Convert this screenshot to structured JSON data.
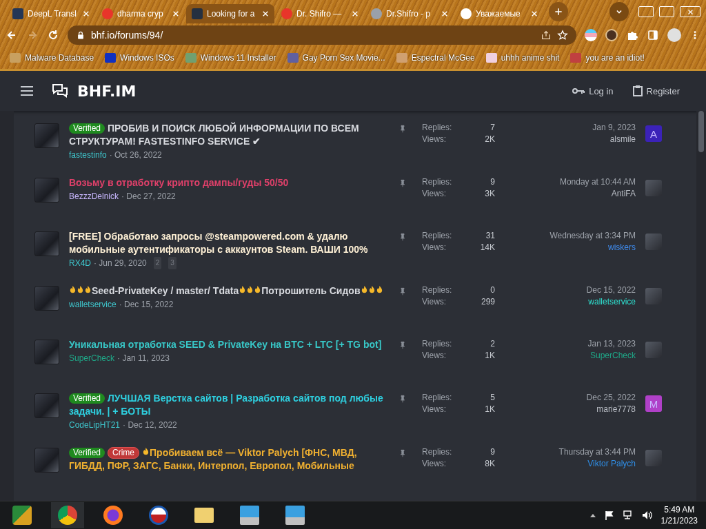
{
  "browser": {
    "tabs": [
      {
        "title": "DeepL Transl",
        "selected": false
      },
      {
        "title": "dharma cryp",
        "selected": false
      },
      {
        "title": "Looking for a",
        "selected": true
      },
      {
        "title": "Dr. Shifro —",
        "selected": false
      },
      {
        "title": "Dr.Shifro - p",
        "selected": false
      },
      {
        "title": "Уважаемые",
        "selected": false
      }
    ],
    "url": "bhf.io/forums/94/",
    "bookmarks": [
      "Malware Database",
      "Windows ISOs",
      "Windows 11 Installer",
      "Gay Porn Sex Movie...",
      "Espectral McGee",
      "uhhh anime shit",
      "you are an idiot!"
    ]
  },
  "site": {
    "logo": "BHF.IM",
    "login": "Log in",
    "register": "Register"
  },
  "threads": [
    {
      "avatar": {
        "kind": "image"
      },
      "prefixes": [
        {
          "kind": "verified",
          "label": "Verified"
        }
      ],
      "title": [
        {
          "kind": "text",
          "text": "ПРОБИВ И ПОИСК ЛЮБОЙ ИНФОРМАЦИИ ПО ВСЕМ СТРУКТУРАМ! FASTESTINFO SERVICE ✔"
        }
      ],
      "color": "#d8dadf",
      "author": {
        "name": "fastestinfo",
        "color": "#3fc9d0"
      },
      "date": "· Oct 26, 2022",
      "replies_label": "Replies:",
      "replies": "7",
      "views_label": "Views:",
      "views": "2K",
      "last_date": "Jan 9, 2023",
      "last_poster": {
        "name": "alsmile",
        "color": "#b8bcc4"
      },
      "last_avatar": {
        "kind": "letter",
        "letter": "A",
        "color": "#3b22b8"
      }
    },
    {
      "avatar": {
        "kind": "image"
      },
      "title": [
        {
          "kind": "text",
          "text": "Возьму в отработку крипто дампы/гуды 50/50"
        }
      ],
      "color": "#e0406a",
      "author": {
        "name": "BezzzDelnick",
        "color": "#c9b8ff"
      },
      "date": "· Dec 27, 2022",
      "replies_label": "Replies:",
      "replies": "9",
      "views_label": "Views:",
      "views": "3K",
      "last_date": "Monday at 10:44 AM",
      "last_poster": {
        "name": "AntiFA",
        "color": "#b8bcc4"
      },
      "last_avatar": {
        "kind": "image"
      }
    },
    {
      "avatar": {
        "kind": "image"
      },
      "title": [
        {
          "kind": "text",
          "text": "[FREE] Обработаю запросы @steampowered.com & удалю мобильные аутентификаторы с аккаунтов Steam. ВАШИ 100%"
        }
      ],
      "color": "#fff1d6",
      "author": {
        "name": "RX4D",
        "color": "#3fc9d0"
      },
      "date": "· Jun 29, 2020",
      "pages": [
        "2",
        "3"
      ],
      "replies_label": "Replies:",
      "replies": "31",
      "views_label": "Views:",
      "views": "14K",
      "last_date": "Wednesday at 3:34 PM",
      "last_poster": {
        "name": "wiskers",
        "color": "#3f8cf0"
      },
      "last_avatar": {
        "kind": "image"
      }
    },
    {
      "avatar": {
        "kind": "image"
      },
      "title": [
        {
          "kind": "flame"
        },
        {
          "kind": "flame"
        },
        {
          "kind": "flame"
        },
        {
          "kind": "text",
          "text": "Seed-PrivateKey / master/ Tdata"
        },
        {
          "kind": "flame"
        },
        {
          "kind": "flame"
        },
        {
          "kind": "flame"
        },
        {
          "kind": "text",
          "text": "Потрошитель Сидов"
        },
        {
          "kind": "flame"
        },
        {
          "kind": "flame"
        },
        {
          "kind": "flame"
        }
      ],
      "color": "#d8dadf",
      "author": {
        "name": "walletservice",
        "color": "#3fc9d0"
      },
      "date": "· Dec 15, 2022",
      "replies_label": "Replies:",
      "replies": "0",
      "views_label": "Views:",
      "views": "299",
      "last_date": "Dec 15, 2022",
      "last_poster": {
        "name": "walletservice",
        "color": "#2ee0d0"
      },
      "last_avatar": {
        "kind": "image"
      }
    },
    {
      "avatar": {
        "kind": "image"
      },
      "title": [
        {
          "kind": "text",
          "text": "Уникальная отработка SEED & PrivateKey на BTC + LTC [+ TG bot]"
        }
      ],
      "color": "#38c8c8",
      "author": {
        "name": "SuperCheck",
        "color": "#1fa888"
      },
      "date": "· Jan 11, 2023",
      "replies_label": "Replies:",
      "replies": "2",
      "views_label": "Views:",
      "views": "1K",
      "last_date": "Jan 13, 2023",
      "last_poster": {
        "name": "SuperCheck",
        "color": "#1fa888"
      },
      "last_avatar": {
        "kind": "image"
      }
    },
    {
      "avatar": {
        "kind": "image"
      },
      "prefixes": [
        {
          "kind": "verified",
          "label": "Verified"
        }
      ],
      "title": [
        {
          "kind": "text",
          "text": "ЛУЧШАЯ Верстка сайтов | Разработка сайтов под любые задачи. | + БОТЫ"
        }
      ],
      "color": "#2ed0e0",
      "author": {
        "name": "CodeLipHT21",
        "color": "#3fc9d0"
      },
      "date": "· Dec 12, 2022",
      "replies_label": "Replies:",
      "replies": "5",
      "views_label": "Views:",
      "views": "1K",
      "last_date": "Dec 25, 2022",
      "last_poster": {
        "name": "marie7778",
        "color": "#b8bcc4"
      },
      "last_avatar": {
        "kind": "letter",
        "letter": "M",
        "color": "#b040c8"
      }
    },
    {
      "avatar": {
        "kind": "image"
      },
      "prefixes": [
        {
          "kind": "verified",
          "label": "Verified"
        },
        {
          "kind": "crime",
          "label": "Crime"
        }
      ],
      "title": [
        {
          "kind": "flame"
        },
        {
          "kind": "text",
          "text": "Пробиваем всё — Viktor Palych [ФНС, МВД, ГИБДД, ПФР, ЗАГС, Банки, Интерпол, Европол, Мобильные"
        }
      ],
      "color": "#f0b030",
      "replies_label": "Replies:",
      "replies": "9",
      "views_label": "Views:",
      "views": "8K",
      "last_date": "Thursday at 3:44 PM",
      "last_poster": {
        "name": "Viktor Palych",
        "color": "#2f8fe8"
      },
      "last_avatar": {
        "kind": "image"
      }
    }
  ],
  "taskbar": {
    "time": "5:49 AM",
    "date": "1/21/2023"
  }
}
